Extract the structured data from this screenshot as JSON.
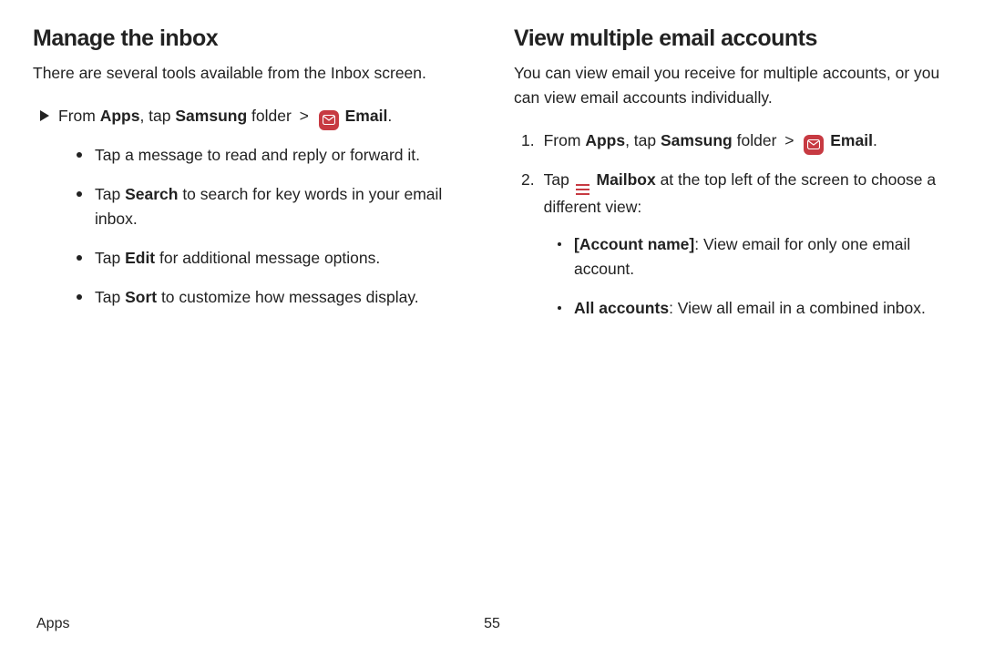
{
  "left": {
    "heading": "Manage the inbox",
    "intro": "There are several tools available from the Inbox screen.",
    "step_from": "From ",
    "apps_word": "Apps",
    "tap_word": ", tap ",
    "samsung_word": "Samsung",
    "folder_word": " folder ",
    "chev": ">",
    "email_word": " Email",
    "period": ".",
    "items": [
      {
        "pre": "Tap a message to read and reply or forward it."
      },
      {
        "pre": "Tap ",
        "bold": "Search",
        "post": " to search for key words in your email inbox."
      },
      {
        "pre": "Tap ",
        "bold": "Edit",
        "post": " for additional message options."
      },
      {
        "pre": "Tap ",
        "bold": "Sort",
        "post": " to customize how messages display."
      }
    ]
  },
  "right": {
    "heading": "View multiple email accounts",
    "intro": "You can view email you receive for multiple accounts, or you can view email accounts individually.",
    "step1_num": "1.",
    "step1_from": "From ",
    "apps_word": "Apps",
    "tap_word": ", tap ",
    "samsung_word": "Samsung",
    "folder_word": " folder ",
    "chev": ">",
    "email_word": " Email",
    "period": ".",
    "step2_num": "2.",
    "step2_pre": "Tap ",
    "step2_mailbox": " Mailbox",
    "step2_post": " at the top left of the screen to choose a different view:",
    "opts": [
      {
        "bold": "[Account name]",
        "post": ": View email for only one email account."
      },
      {
        "bold": "All accounts",
        "post": ": View all email in a combined inbox."
      }
    ]
  },
  "footer": {
    "section": "Apps",
    "page": "55"
  }
}
